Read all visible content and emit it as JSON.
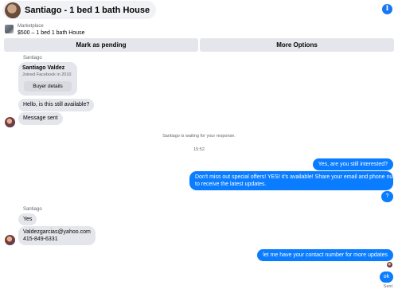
{
  "header": {
    "title": "Santiago - 1 bed 1 bath House",
    "info_icon": "i"
  },
  "listing": {
    "source": "Marketplace",
    "price_title": "$500 – 1 bed 1 bath House"
  },
  "actions": {
    "mark_pending": "Mark as pending",
    "more_options": "More Options"
  },
  "conversation": {
    "sender_label_1": "Santiago",
    "card": {
      "name": "Santiago Valdez",
      "joined": "Joined Facebook in 2010",
      "details_button": "Buyer details"
    },
    "msg_available": "Hello, is this still available?",
    "msg_sent": "Message sent",
    "waiting_note": "Santiago is waiting for your response.",
    "timestamp": "15:52",
    "out_1": "Yes, are you still interested?",
    "out_2_line1": "Don't miss out special offers! YES! it's available! Share your email and phone number",
    "out_2_line2": "to receive the latest updates.",
    "out_3": "?",
    "sender_label_2": "Santiago",
    "in_yes": "Yes",
    "in_email": "Valdezgarcias@yahoo.com",
    "in_phone": "415-849-6331",
    "out_4": "let me have your contact number for more updates",
    "out_5": "ok",
    "status_sent": "Sent"
  },
  "colors": {
    "outgoing": "#0a7cff",
    "incoming": "#e4e6eb",
    "accent": "#1877f2"
  }
}
